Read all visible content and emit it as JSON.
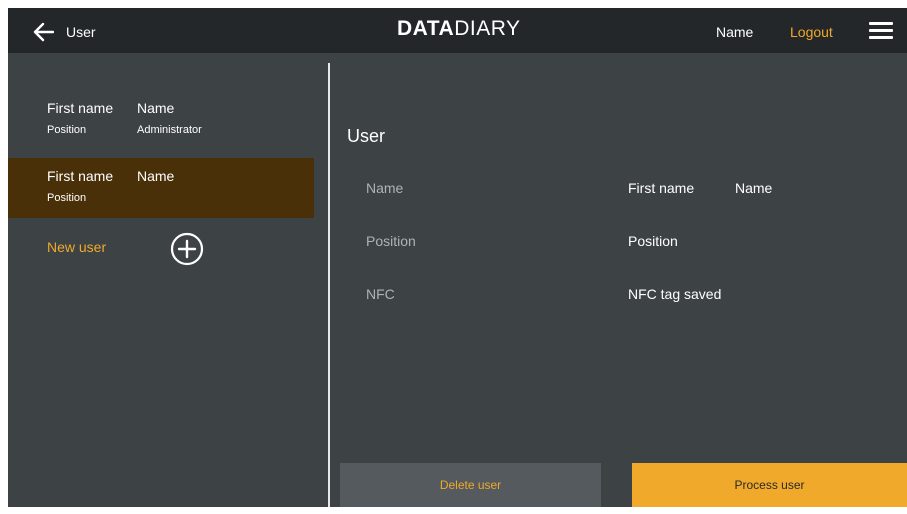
{
  "header": {
    "back_label": "User",
    "logo_bold": "DATA",
    "logo_light": "DIARY",
    "user_name": "Name",
    "logout_label": "Logout"
  },
  "sidebar": {
    "users": [
      {
        "first_name": "First name",
        "last_name": "Name",
        "position_label": "Position",
        "position_value": "Administrator",
        "selected": false
      },
      {
        "first_name": "First name",
        "last_name": "Name",
        "position_label": "Position",
        "position_value": "",
        "selected": true
      }
    ],
    "new_user_label": "New user"
  },
  "detail": {
    "title": "User",
    "fields": [
      {
        "label": "Name",
        "value": "First name",
        "value2": "Name"
      },
      {
        "label": "Position",
        "value": "Position"
      },
      {
        "label": "NFC",
        "value": "NFC tag saved"
      }
    ]
  },
  "actions": {
    "delete_label": "Delete user",
    "process_label": "Process user"
  },
  "colors": {
    "accent": "#f0a92a",
    "topbar": "#232729",
    "background": "#3d4245",
    "selected_row": "#4a3008",
    "secondary_button": "#545a5e"
  }
}
